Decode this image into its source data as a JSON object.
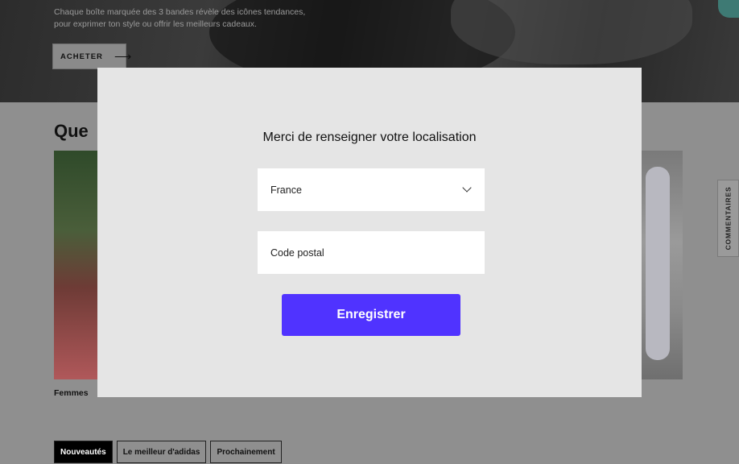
{
  "hero": {
    "description_line1": "Chaque boîte marquée des 3 bandes révèle des icônes tendances,",
    "description_line2": "pour exprimer ton style ou offrir les meilleurs cadeaux.",
    "buy_label": "ACHETER"
  },
  "section": {
    "title": "Que ",
    "card_left_label": "Femmes"
  },
  "comments_tab": {
    "label": "COMMENTAIRES"
  },
  "tabs": [
    {
      "label": "Nouveautés"
    },
    {
      "label": "Le meilleur d'adidas"
    },
    {
      "label": "Prochainement"
    }
  ],
  "modal": {
    "title": "Merci de renseigner votre localisation",
    "country_value": "France",
    "postal_placeholder": "Code postal",
    "save_label": "Enregistrer"
  },
  "colors": {
    "accent": "#5033ff",
    "overlay": "#8f8f8f",
    "modal_bg": "#e5e5e5"
  }
}
